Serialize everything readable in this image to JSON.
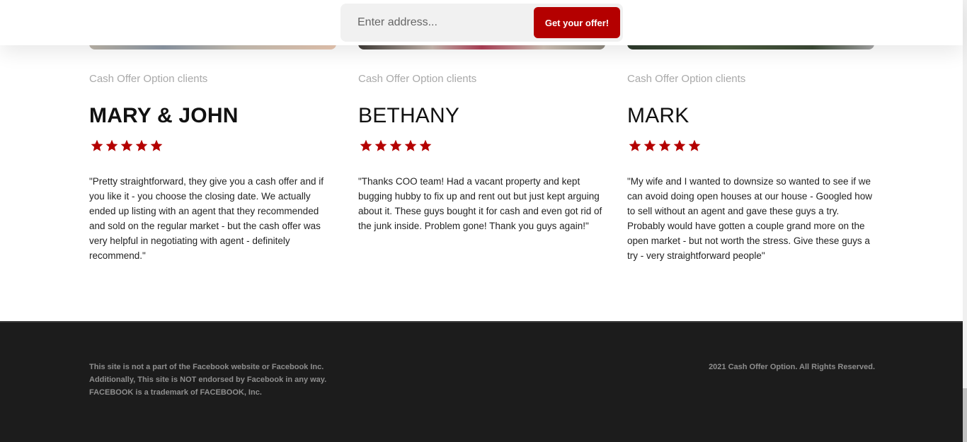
{
  "header": {
    "address_placeholder": "Enter address...",
    "offer_button_label": "Get your offer!"
  },
  "colors": {
    "accent": "#b40000",
    "star": "#b40000",
    "footer_bg": "#1c1c1c"
  },
  "testimonials": [
    {
      "kicker": "Cash Offer Option clients",
      "name": "MARY & JOHN",
      "rating": 5,
      "quote": "\"Pretty straightforward, they give you a cash offer and if you like it - you choose the closing date. We actually ended up listing with an agent that they recommended and sold on the regular market - but the cash offer was very helpful in negotiating with agent - definitely recommend.\""
    },
    {
      "kicker": "Cash Offer Option clients",
      "name": "BETHANY",
      "rating": 5,
      "quote": "\"Thanks COO team! Had a vacant property and kept bugging hubby to fix up and rent out but just kept arguing about it. These guys bought it for cash and even got rid of the junk inside. Problem gone! Thank you guys again!\""
    },
    {
      "kicker": "Cash Offer Option clients",
      "name": "MARK",
      "rating": 5,
      "quote": "\"My wife and I wanted to downsize so wanted to see if we can avoid doing open houses at our house - Googled how to sell without an agent and gave these guys a try. Probably would have gotten a couple grand more on the open market - but not worth the stress. Give these guys a try - very straightforward people\""
    }
  ],
  "footer": {
    "disclaimer_lines": [
      "This site is not a part of the Facebook website or Facebook Inc.",
      "Additionally, This site is NOT endorsed by Facebook in any way.",
      "FACEBOOK is a trademark of FACEBOOK, Inc."
    ],
    "copyright": "2021 Cash Offer Option. All Rights Reserved."
  }
}
